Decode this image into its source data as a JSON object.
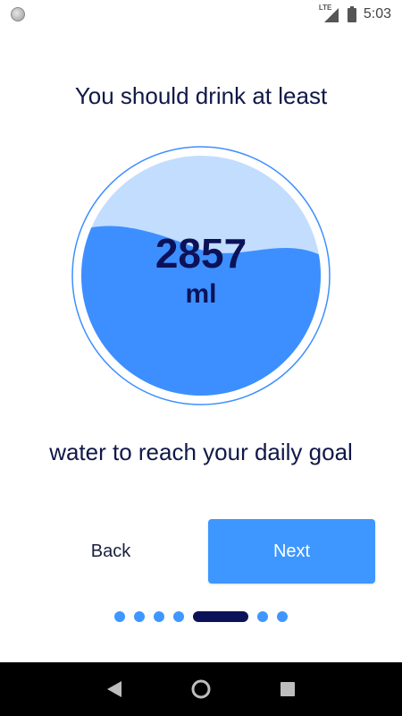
{
  "status_bar": {
    "network_label": "LTE",
    "time": "5:03"
  },
  "onboarding": {
    "headline": "You should drink at least",
    "amount": "2857",
    "unit": "ml",
    "subline": "water to reach your daily goal",
    "back_label": "Back",
    "next_label": "Next"
  },
  "pager": {
    "total": 7,
    "active_index": 4
  },
  "colors": {
    "accent": "#3d97ff",
    "water": "#3d8fff",
    "water_light": "#c3ddff",
    "text_dark": "#0c1257"
  },
  "icons": {
    "status": "notification-circle-icon",
    "signal": "signal-icon",
    "battery": "battery-icon",
    "back_nav": "triangle-back-icon",
    "home_nav": "circle-home-icon",
    "recents_nav": "square-recents-icon"
  }
}
